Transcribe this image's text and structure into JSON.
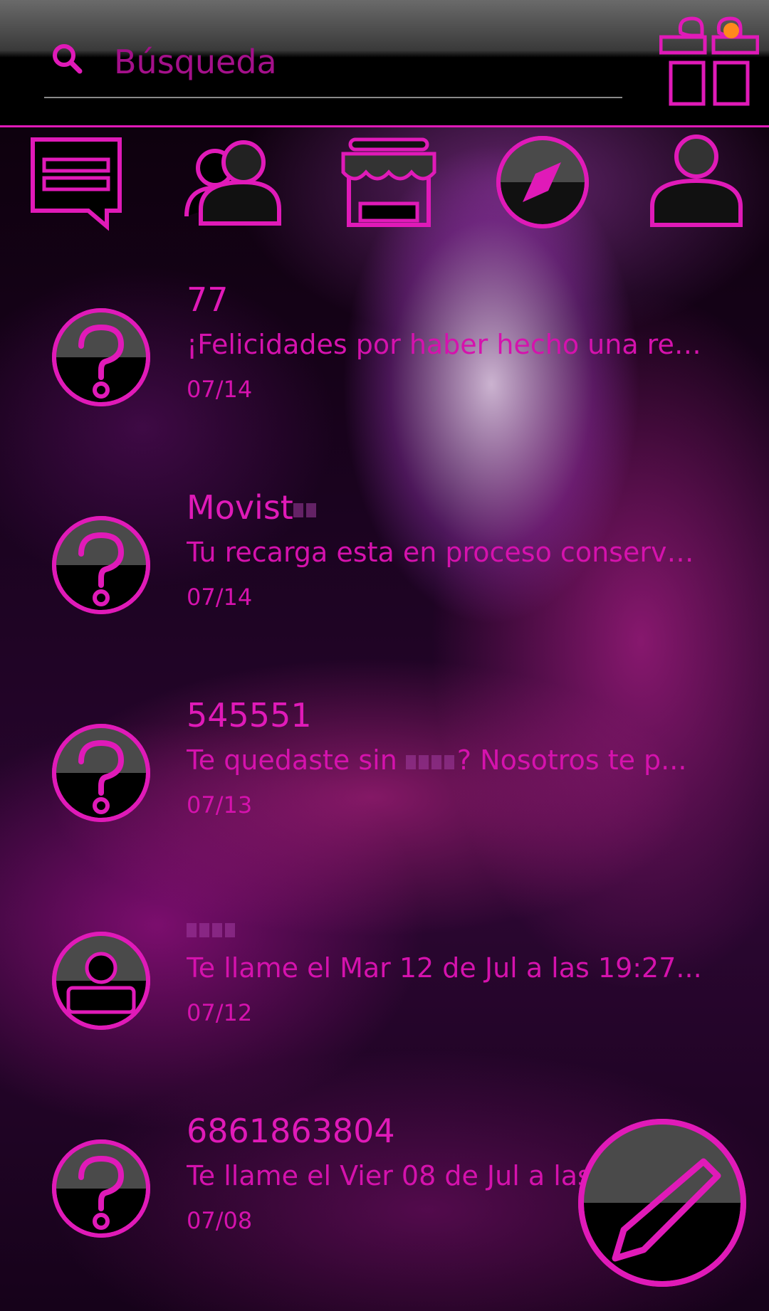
{
  "search": {
    "placeholder": "Búsqueda"
  },
  "tabs": [
    {
      "id": "messages",
      "icon": "message-icon"
    },
    {
      "id": "contacts",
      "icon": "contacts-icon"
    },
    {
      "id": "store",
      "icon": "store-icon"
    },
    {
      "id": "explore",
      "icon": "compass-icon"
    },
    {
      "id": "profile",
      "icon": "profile-icon"
    }
  ],
  "conversations": [
    {
      "name": "77",
      "snippet": "¡Felicidades por haber hecho una rec...",
      "date": "07/14",
      "avatar": "unknown-contact-icon"
    },
    {
      "name": "Movist",
      "snippet": "Tu recarga esta en proceso conserva...",
      "date": "07/14",
      "avatar": "unknown-contact-icon"
    },
    {
      "name": "545551",
      "snippet_before": "Te quedaste sin",
      "snippet_after": "? Nosotros te p...",
      "date": "07/13",
      "avatar": "unknown-contact-icon"
    },
    {
      "name": "",
      "snippet": "Te llame el Mar 12 de Jul a las 19:27...",
      "date": "07/12",
      "avatar": "contact-person-icon"
    },
    {
      "name": "6861863804",
      "snippet": "Te llame el Vier 08 de Jul a las",
      "date": "07/08",
      "avatar": "unknown-contact-icon"
    }
  ],
  "colors": {
    "accent": "#e01ab8",
    "badge": "#ff8a1c"
  }
}
